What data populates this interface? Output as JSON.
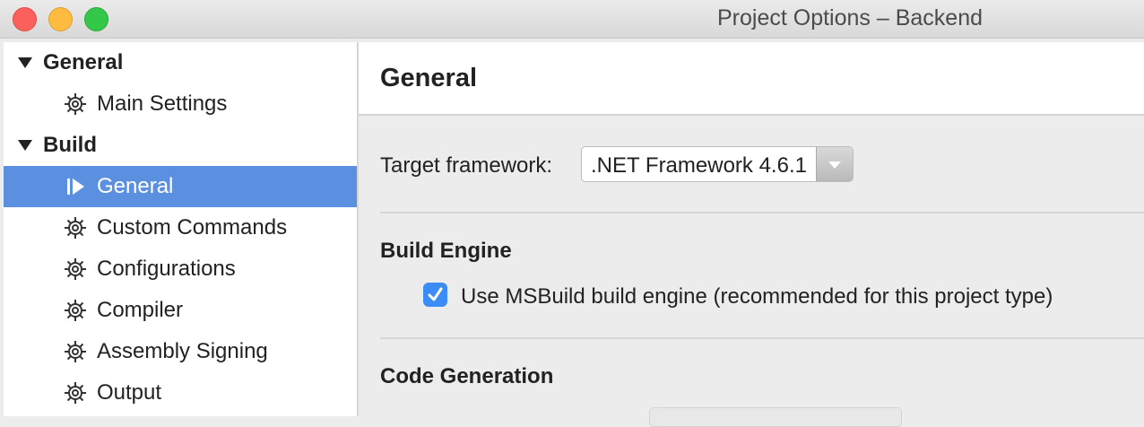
{
  "window": {
    "title": "Project Options – Backend"
  },
  "sidebar": {
    "sections": [
      {
        "label": "General",
        "items": [
          {
            "label": "Main Settings",
            "icon": "gear-icon"
          }
        ]
      },
      {
        "label": "Build",
        "items": [
          {
            "label": "General",
            "icon": "play-marker-icon",
            "selected": true
          },
          {
            "label": "Custom Commands",
            "icon": "gear-icon"
          },
          {
            "label": "Configurations",
            "icon": "gear-icon"
          },
          {
            "label": "Compiler",
            "icon": "gear-icon"
          },
          {
            "label": "Assembly Signing",
            "icon": "gear-icon"
          },
          {
            "label": "Output",
            "icon": "gear-icon"
          }
        ]
      }
    ],
    "selected_color": "#5b8fe0"
  },
  "main": {
    "title": "General",
    "target_framework_label": "Target framework:",
    "target_framework_value": ".NET Framework 4.6.1",
    "build_engine_heading": "Build Engine",
    "msbuild_checkbox_label": "Use MSBuild build engine (recommended for this project type)",
    "msbuild_checked": true,
    "code_generation_heading": "Code Generation"
  },
  "colors": {
    "checkbox_accent": "#3b8cf5"
  }
}
